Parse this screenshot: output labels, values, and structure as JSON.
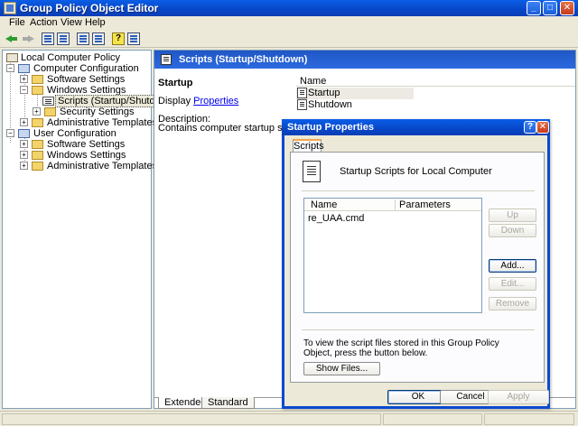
{
  "window": {
    "title": "Group Policy Object Editor"
  },
  "menu": {
    "file": "File",
    "action": "Action",
    "view": "View",
    "help": "Help"
  },
  "tree": {
    "root": "Local Computer Policy",
    "computer_config": "Computer Configuration",
    "software_settings": "Software Settings",
    "windows_settings": "Windows Settings",
    "scripts": "Scripts (Startup/Shutdown)",
    "security_settings": "Security Settings",
    "admin_templates": "Administrative Templates",
    "user_config": "User Configuration",
    "user_software_settings": "Software Settings",
    "user_windows_settings": "Windows Settings",
    "user_admin_templates": "Administrative Templates"
  },
  "right_pane": {
    "header": "Scripts (Startup/Shutdown)",
    "desc_title": "Startup",
    "display_prefix": "Display ",
    "display_link": "Properties",
    "desc_label": "Description:",
    "desc_text": "Contains computer startup scripts.",
    "list_header": "Name",
    "items": [
      "Startup",
      "Shutdown"
    ],
    "tabs": [
      "Extended",
      "Standard"
    ]
  },
  "dialog": {
    "title": "Startup Properties",
    "tab": "Scripts",
    "panel_title": "Startup Scripts for Local Computer",
    "columns": [
      "Name",
      "Parameters"
    ],
    "rows": [
      "re_UAA.cmd"
    ],
    "buttons": {
      "up": "Up",
      "down": "Down",
      "add": "Add...",
      "edit": "Edit...",
      "remove": "Remove",
      "show_files": "Show Files..."
    },
    "hint": "To view the script files stored in this Group Policy Object, press the button below.",
    "footer": {
      "ok": "OK",
      "cancel": "Cancel",
      "apply": "Apply"
    }
  }
}
